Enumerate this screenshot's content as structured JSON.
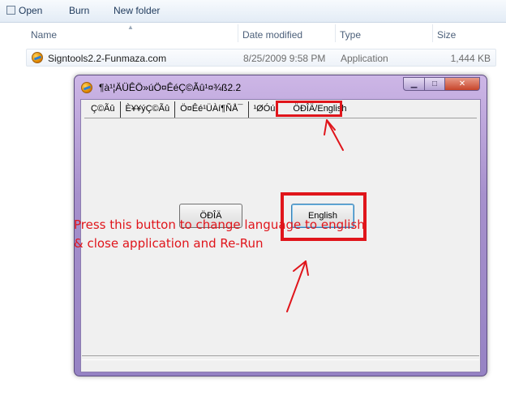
{
  "toolbar": {
    "open_label": "Open",
    "burn_label": "Burn",
    "new_folder_label": "New folder"
  },
  "columns": {
    "name": "Name",
    "date_modified": "Date modified",
    "type": "Type",
    "size": "Size"
  },
  "file": {
    "name": "Signtools2.2-Funmaza.com",
    "date": "8/25/2009 9:58 PM",
    "type": "Application",
    "size": "1,444 KB",
    "icon": "signtools-app-icon"
  },
  "window": {
    "title": "¶à¹¦ÄÜÊÖ»úÖ¤ÊéÇ©Ãû¹¤¾ß2.2",
    "tabs": [
      {
        "label": "Ç©Ãû"
      },
      {
        "label": "È¥¥ýÇ©Ãû"
      },
      {
        "label": "Ö¤Êé¹ÜÀí¶ÑÅ¯"
      },
      {
        "label": "¹ØÓú"
      },
      {
        "label": "ÖÐÎÄ/English"
      }
    ],
    "chinese_button_label": "ÖÐÎÄ",
    "english_button_label": "English"
  },
  "annotation": {
    "line1": "Press this button to change language to english",
    "line2": "& close application and Re-Run",
    "color": "#e0151b"
  }
}
